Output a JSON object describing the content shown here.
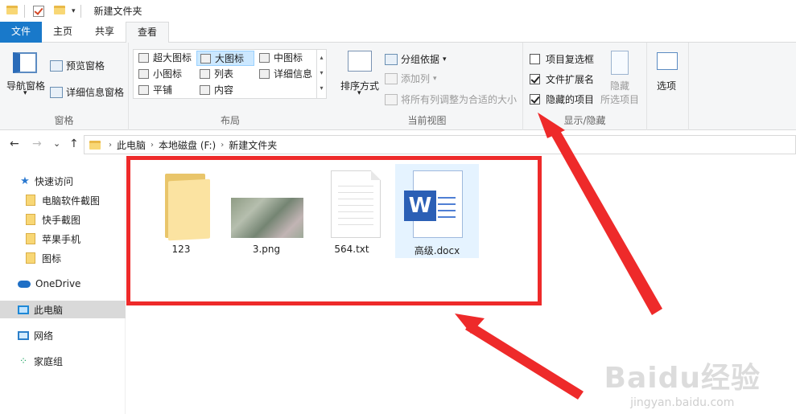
{
  "titlebar": {
    "title": "新建文件夹",
    "dropdown_glyph": "▾"
  },
  "tabs": [
    {
      "label": "文件"
    },
    {
      "label": "主页"
    },
    {
      "label": "共享"
    },
    {
      "label": "查看"
    }
  ],
  "ribbon": {
    "panes": {
      "label": "窗格",
      "nav_pane": "导航窗格",
      "nav_pane_arrow": "▾",
      "preview_pane": "预览窗格",
      "details_pane": "详细信息窗格"
    },
    "layout": {
      "label": "布局",
      "options": [
        {
          "label": "超大图标",
          "selected": false
        },
        {
          "label": "大图标",
          "selected": true
        },
        {
          "label": "中图标",
          "selected": false
        },
        {
          "label": "小图标",
          "selected": false
        },
        {
          "label": "列表",
          "selected": false
        },
        {
          "label": "详细信息",
          "selected": false
        },
        {
          "label": "平铺",
          "selected": false
        },
        {
          "label": "内容",
          "selected": false
        }
      ],
      "scroll_up": "▴",
      "scroll_down": "▾",
      "scroll_more": "▾"
    },
    "current_view": {
      "label": "当前视图",
      "sort_by": "排序方式",
      "sort_arrow": "▾",
      "group_by": "分组依据",
      "group_by_arrow": "▾",
      "add_column": "添加列",
      "add_column_arrow": "▾",
      "fit_columns": "将所有列调整为合适的大小"
    },
    "show_hide": {
      "label": "显示/隐藏",
      "checkboxes": [
        {
          "label": "项目复选框",
          "checked": false
        },
        {
          "label": "文件扩展名",
          "checked": true
        },
        {
          "label": "隐藏的项目",
          "checked": true
        }
      ],
      "hide_selected_line1": "隐藏",
      "hide_selected_line2": "所选项目"
    },
    "options": {
      "label": "选项"
    }
  },
  "address": {
    "back": "←",
    "forward": "→",
    "recent": "⌄",
    "up": "↑",
    "breadcrumbs": [
      "此电脑",
      "本地磁盘 (F:)",
      "新建文件夹"
    ],
    "separator": "›"
  },
  "sidebar": {
    "quick_access": "快速访问",
    "pinned": [
      "电脑软件截图",
      "快手截图",
      "苹果手机",
      "图标"
    ],
    "onedrive": "OneDrive",
    "this_pc": "此电脑",
    "network": "网络",
    "homegroup": "家庭组",
    "star_glyph": "★",
    "home_glyph": "⁘"
  },
  "files": [
    {
      "name": "123",
      "type": "folder",
      "selected": false
    },
    {
      "name": "3.png",
      "type": "image",
      "selected": false
    },
    {
      "name": "564.txt",
      "type": "text",
      "selected": false
    },
    {
      "name": "高级.docx",
      "type": "word",
      "selected": true
    }
  ],
  "word_badge": "W",
  "annotation_color": "#ee2a2a",
  "watermark": {
    "main": "Baidu经验",
    "sub": "jingyan.baidu.com"
  }
}
